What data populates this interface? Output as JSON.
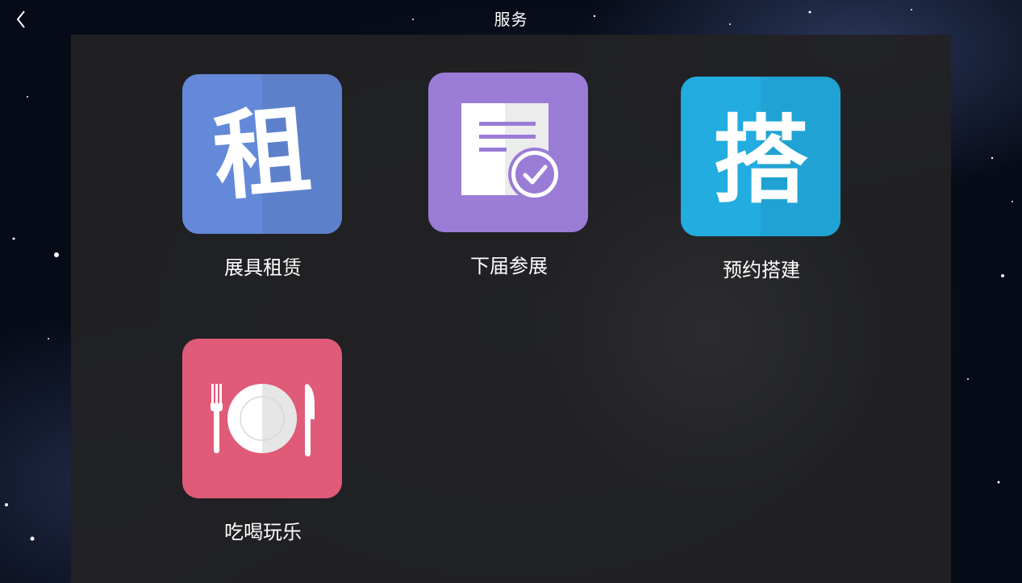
{
  "header": {
    "title": "服务"
  },
  "services": [
    {
      "label": "展具租赁",
      "icon_char": "租",
      "icon": "rent-icon",
      "color": "#6389d8"
    },
    {
      "label": "下届参展",
      "icon": "document-check-icon",
      "color": "#9a7cd6"
    },
    {
      "label": "预约搭建",
      "icon_char": "搭",
      "icon": "build-icon",
      "color": "#22ace0"
    },
    {
      "label": "吃喝玩乐",
      "icon": "dining-plate-icon",
      "color": "#e05b77"
    }
  ]
}
